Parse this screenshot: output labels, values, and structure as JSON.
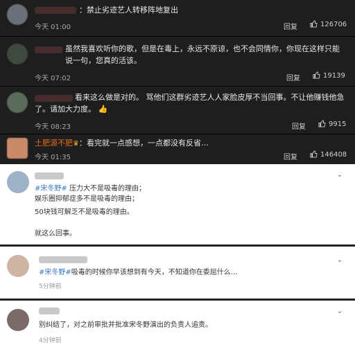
{
  "comments_dark": [
    {
      "text": "：禁止劣迹艺人转移阵地复出",
      "time": "今天 01:00",
      "reply": "回复",
      "likes": "126706"
    },
    {
      "text": "虽然我喜欢听你的歌，但是在毒上，永远不原谅，也不会同情你，你现在这样只能说一句，您真的活该。",
      "time": "今天 07:02",
      "reply": "回复",
      "likes": "19139"
    },
    {
      "text": "看来这么做是对的。 骂他们这群劣迹艺人人家脸皮厚不当回事。不让他赚钱他急了。请加大力度。",
      "time": "今天 08:23",
      "reply": "回复",
      "likes": "9915"
    },
    {
      "username": "土肥源不肥",
      "text": "：看完就一点感想，一点都没有反省…",
      "time": "今天 01:35",
      "reply": "回复",
      "likes": "146408"
    }
  ],
  "comments_light": [
    {
      "topic": "#宋冬野#",
      "lines": [
        "压力大不是吸毒的理由；",
        "娱乐圈抑郁症多不是吸毒的理由；",
        "50块钱可解乏不是吸毒的理由。",
        "",
        "就这么回事。"
      ]
    },
    {
      "topic": "#宋冬野#",
      "text": "吸毒的时候你早该想到有今天，不知道你在委屈什么…",
      "time": "5分钟前"
    },
    {
      "text": "别纠结了，对之前审批并批准宋冬野演出的负责人追责。",
      "time": "4分钟前"
    }
  ]
}
